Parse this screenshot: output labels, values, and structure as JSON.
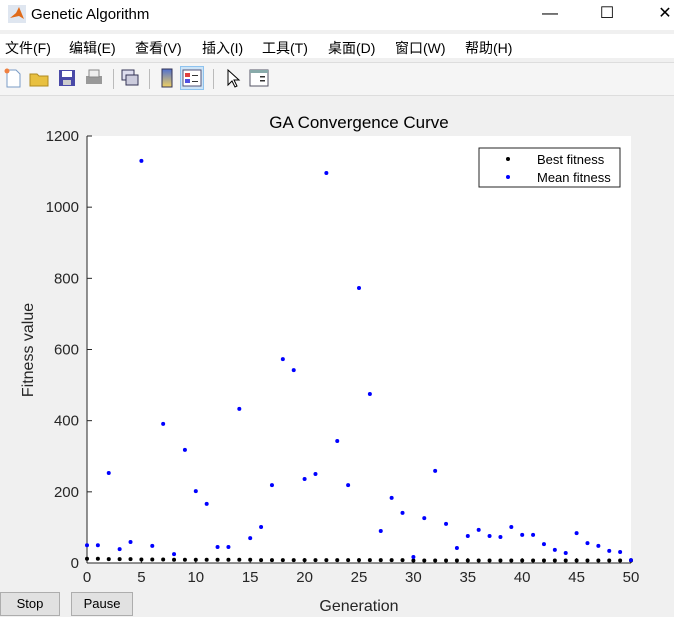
{
  "window": {
    "title": "Genetic Algorithm",
    "minimize": "—",
    "maximize": "☐",
    "close": "✕"
  },
  "menu": [
    "文件(F)",
    "编辑(E)",
    "查看(V)",
    "插入(I)",
    "工具(T)",
    "桌面(D)",
    "窗口(W)",
    "帮助(H)"
  ],
  "toolbar": [
    "new-figure-icon",
    "open-icon",
    "save-icon",
    "print-icon",
    "link-icon",
    "colorbar-icon",
    "legend-icon",
    "pointer-icon",
    "property-inspector-icon"
  ],
  "buttons": {
    "stop": "Stop",
    "pause": "Pause"
  },
  "chart_data": {
    "type": "scatter",
    "title": "GA Convergence Curve",
    "xlabel": "Generation",
    "ylabel": "Fitness value",
    "xlim": [
      0,
      50
    ],
    "ylim": [
      0,
      1200
    ],
    "xticks": [
      0,
      5,
      10,
      15,
      20,
      25,
      30,
      35,
      40,
      45,
      50
    ],
    "yticks": [
      0,
      200,
      400,
      600,
      800,
      1000,
      1200
    ],
    "legend_position": "top-right",
    "x": [
      0,
      1,
      2,
      3,
      4,
      5,
      6,
      7,
      8,
      9,
      10,
      11,
      12,
      13,
      14,
      15,
      16,
      17,
      18,
      19,
      20,
      21,
      22,
      23,
      24,
      25,
      26,
      27,
      28,
      29,
      30,
      31,
      32,
      33,
      34,
      35,
      36,
      37,
      38,
      39,
      40,
      41,
      42,
      43,
      44,
      45,
      46,
      47,
      48,
      49,
      50
    ],
    "series": [
      {
        "name": "Best fitness",
        "color": "#000000",
        "values": [
          12,
          12,
          11,
          11,
          11,
          10,
          10,
          10,
          9,
          9,
          9,
          9,
          9,
          9,
          9,
          9,
          8,
          8,
          8,
          8,
          8,
          8,
          8,
          8,
          8,
          8,
          8,
          8,
          8,
          8,
          7,
          7,
          7,
          7,
          7,
          7,
          7,
          7,
          7,
          7,
          7,
          7,
          7,
          7,
          7,
          7,
          7,
          7,
          7,
          7,
          7
        ]
      },
      {
        "name": "Mean fitness",
        "color": "#0000ff",
        "values": [
          50,
          50,
          253,
          39,
          59,
          1130,
          48,
          391,
          25,
          318,
          202,
          166,
          45,
          45,
          433,
          70,
          101,
          219,
          573,
          542,
          236,
          250,
          1096,
          343,
          219,
          773,
          475,
          90,
          183,
          141,
          17,
          126,
          259,
          110,
          42,
          76,
          93,
          76,
          73,
          101,
          79,
          79,
          53,
          37,
          28,
          84,
          56,
          48,
          34,
          31,
          8
        ]
      }
    ]
  }
}
